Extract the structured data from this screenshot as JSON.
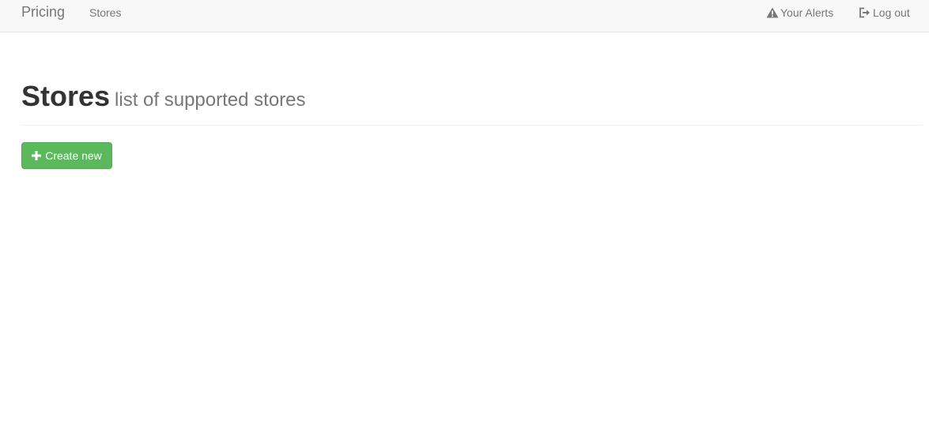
{
  "navbar": {
    "brand": "Pricing",
    "links": [
      {
        "label": "Stores"
      }
    ],
    "right_links": [
      {
        "label": "Your Alerts",
        "icon": "warning-icon"
      },
      {
        "label": "Log out",
        "icon": "logout-icon"
      }
    ]
  },
  "header": {
    "title": "Stores",
    "subtitle": "list of supported stores"
  },
  "actions": {
    "create_label": "Create new",
    "create_icon": "plus-icon"
  },
  "colors": {
    "navbar_bg": "#f8f8f8",
    "success": "#5cb85c",
    "muted_text": "#777777",
    "text": "#333333"
  }
}
